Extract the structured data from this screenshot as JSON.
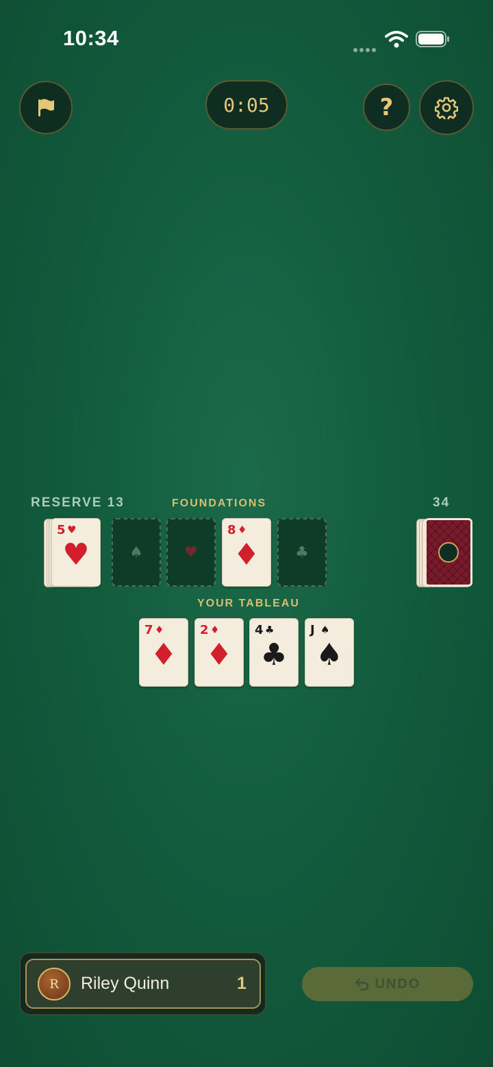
{
  "status_bar": {
    "time": "10:34"
  },
  "toolbar": {
    "timer": "0:05",
    "help_label": "?"
  },
  "labels": {
    "reserve": "RESERVE 13",
    "foundations": "FOUNDATIONS",
    "stock_count": "34",
    "tableau": "YOUR TABLEAU"
  },
  "reserve_top": {
    "rank": "5",
    "suit": "♥",
    "color": "red"
  },
  "foundations": [
    {
      "state": "empty",
      "suit": "♠"
    },
    {
      "state": "empty",
      "suit": "♥"
    },
    {
      "state": "card",
      "rank": "8",
      "suit": "♦",
      "color": "red"
    },
    {
      "state": "empty",
      "suit": "♣"
    }
  ],
  "tableau": [
    {
      "rank": "7",
      "suit": "♦",
      "color": "red"
    },
    {
      "rank": "2",
      "suit": "♦",
      "color": "red"
    },
    {
      "rank": "4",
      "suit": "♣",
      "color": "black"
    },
    {
      "rank": "J",
      "suit": "♠",
      "color": "black"
    }
  ],
  "player": {
    "initial": "R",
    "name": "Riley Quinn",
    "score": "1"
  },
  "undo": {
    "label": "UNDO"
  },
  "colors": {
    "felt": "#135c3e",
    "gold": "#e5c77a",
    "card_red": "#d21f2b",
    "card_back": "#7a1a2b"
  }
}
